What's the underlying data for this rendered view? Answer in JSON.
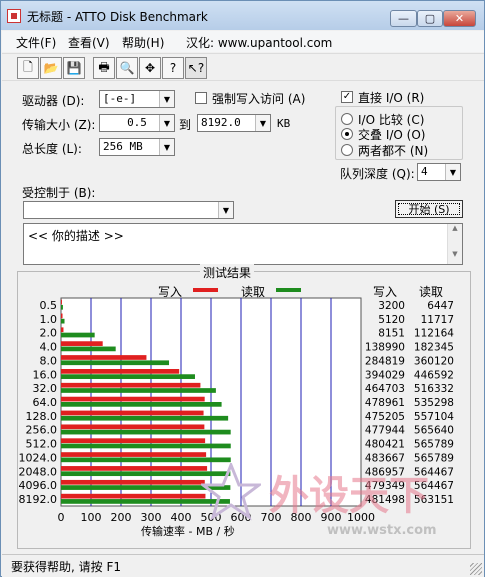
{
  "window": {
    "title": "无标题 - ATTO Disk Benchmark"
  },
  "titlebar_buttons": {
    "minimize": "—",
    "maximize": "▢",
    "close": "✕"
  },
  "menu": [
    {
      "label": "文件(F)"
    },
    {
      "label": "查看(V)"
    },
    {
      "label": "帮助(H)"
    },
    {
      "label": "汉化: www.upantool.com"
    }
  ],
  "toolbar": [
    {
      "icon": "new-document-icon",
      "glyph": "🗋"
    },
    {
      "icon": "open-folder-icon",
      "glyph": "📂"
    },
    {
      "icon": "save-icon",
      "glyph": "💾"
    },
    {
      "icon": "print-icon",
      "glyph": "🖶"
    },
    {
      "icon": "print-preview-icon",
      "glyph": "🔍"
    },
    {
      "icon": "move-icon",
      "glyph": "✥"
    },
    {
      "icon": "help-icon",
      "glyph": "?"
    },
    {
      "icon": "context-help-icon",
      "glyph": "↖?"
    }
  ],
  "form": {
    "drive_label": "驱动器 (D):",
    "drive_value": "[-e-]",
    "force_write_label": "强制写入访问 (A)",
    "transfer_size_label": "传输大小 (Z):",
    "transfer_from": "0.5",
    "to_label": "到",
    "transfer_to": "8192.0",
    "kb_label": "KB",
    "total_length_label": "总长度 (L):",
    "total_length_value": "256 MB",
    "direct_io_label": "直接 I/O (R)",
    "io_compare_label": "I/O 比较 (C)",
    "overlap_io_label": "交叠 I/O (O)",
    "neither_label": "两者都不 (N)",
    "queue_depth_label": "队列深度 (Q):",
    "queue_depth_value": "4",
    "controlled_by_label": "受控制于 (B):",
    "controlled_by_value": "",
    "start_button": "开始 (S)",
    "description": "<<    你的描述     >>"
  },
  "results": {
    "title": "测试结果",
    "legend_write": "写入",
    "legend_read": "读取",
    "col_write": "写入",
    "col_read": "读取",
    "xlabel": "传输速率 - MB / 秒"
  },
  "chart_data": {
    "type": "bar",
    "orientation": "horizontal",
    "title": "测试结果",
    "xlabel": "传输速率 - MB / 秒",
    "ylabel": "",
    "xlim": [
      0,
      1000
    ],
    "x_ticks": [
      "0",
      "100",
      "200",
      "300",
      "400",
      "500",
      "600",
      "700",
      "800",
      "900",
      "1000"
    ],
    "grid": true,
    "categories": [
      "0.5",
      "1.0",
      "2.0",
      "4.0",
      "8.0",
      "16.0",
      "32.0",
      "64.0",
      "128.0",
      "256.0",
      "512.0",
      "1024.0",
      "2048.0",
      "4096.0",
      "8192.0"
    ],
    "series": [
      {
        "name": "写入",
        "color": "#e02020",
        "values": [
          3.2,
          5.1,
          8.2,
          138.99,
          284.8,
          394.0,
          464.7,
          478.96,
          475.2,
          477.9,
          480.4,
          483.7,
          486.96,
          479.3,
          481.5
        ],
        "labels": [
          "3200",
          "5120",
          "8151",
          "138990",
          "284819",
          "394029",
          "464703",
          "478961",
          "475205",
          "477944",
          "480421",
          "483667",
          "486957",
          "479349",
          "481498"
        ]
      },
      {
        "name": "读取",
        "color": "#1e8c1e",
        "values": [
          6.4,
          11.7,
          112.2,
          182.3,
          360.1,
          446.6,
          516.3,
          535.3,
          557.1,
          565.6,
          565.8,
          565.8,
          564.5,
          564.5,
          563.2
        ],
        "labels": [
          "6447",
          "11717",
          "112164",
          "182345",
          "360120",
          "446592",
          "516332",
          "535298",
          "557104",
          "565640",
          "565789",
          "565789",
          "564467",
          "564467",
          "563151"
        ]
      }
    ]
  },
  "status": {
    "text": "要获得帮助, 请按 F1"
  },
  "watermark": {
    "text": "外设天下",
    "url": "www.wstx.com"
  }
}
